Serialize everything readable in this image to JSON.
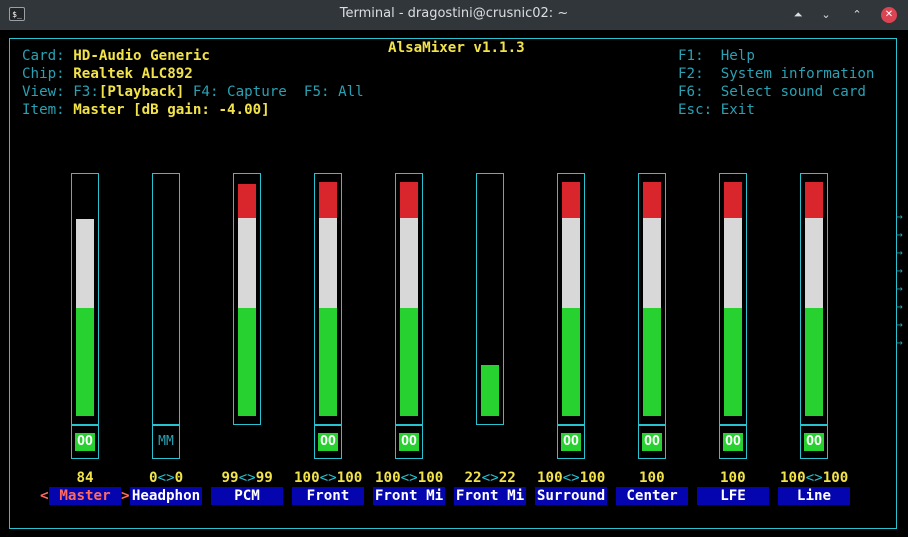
{
  "window": {
    "title": "Terminal - dragostini@crusnic02: ~",
    "app_icon": "$_",
    "buttons": {
      "keep_above": "⏶",
      "minimize": "⌄",
      "maximize": "⌃",
      "close": "✕"
    }
  },
  "app": {
    "title": "AlsaMixer v1.1.3"
  },
  "info": {
    "card_label": "Card:",
    "card_value": "HD-Audio Generic",
    "chip_label": "Chip:",
    "chip_value": "Realtek ALC892",
    "view_label": "View:",
    "view_f3": "F3:",
    "view_f3_value": "[Playback]",
    "view_f4": "F4: Capture",
    "view_f5": "F5: All",
    "item_label": "Item:",
    "item_value": "Master [dB gain: -4.00]"
  },
  "keys": [
    {
      "key": "F1:",
      "action": "Help"
    },
    {
      "key": "F2:",
      "action": "System information"
    },
    {
      "key": "F6:",
      "action": "Select sound card"
    },
    {
      "key": "Esc:",
      "action": "Exit"
    }
  ],
  "channels": [
    {
      "name": "Master",
      "selected": true,
      "value_left": "84",
      "value_sep": "",
      "value_right": "",
      "level": 0.84,
      "switch": "OO",
      "has_switch": true
    },
    {
      "name": "Headphon",
      "selected": false,
      "value_left": "0",
      "value_sep": "<>",
      "value_right": "0",
      "level": 0.0,
      "switch": "MM",
      "has_switch": true
    },
    {
      "name": "PCM",
      "selected": false,
      "value_left": "99",
      "value_sep": "<>",
      "value_right": "99",
      "level": 0.99,
      "switch": "",
      "has_switch": false
    },
    {
      "name": "Front",
      "selected": false,
      "value_left": "100",
      "value_sep": "<>",
      "value_right": "100",
      "level": 1.0,
      "switch": "OO",
      "has_switch": true
    },
    {
      "name": "Front Mi",
      "selected": false,
      "value_left": "100",
      "value_sep": "<>",
      "value_right": "100",
      "level": 1.0,
      "switch": "OO",
      "has_switch": true
    },
    {
      "name": "Front Mi",
      "selected": false,
      "value_left": "22",
      "value_sep": "<>",
      "value_right": "22",
      "level": 0.22,
      "switch": "",
      "has_switch": false
    },
    {
      "name": "Surround",
      "selected": false,
      "value_left": "100",
      "value_sep": "<>",
      "value_right": "100",
      "level": 1.0,
      "switch": "OO",
      "has_switch": true
    },
    {
      "name": "Center",
      "selected": false,
      "value_left": "100",
      "value_sep": "",
      "value_right": "",
      "level": 1.0,
      "switch": "OO",
      "has_switch": true
    },
    {
      "name": "LFE",
      "selected": false,
      "value_left": "100",
      "value_sep": "",
      "value_right": "",
      "level": 1.0,
      "switch": "OO",
      "has_switch": true
    },
    {
      "name": "Line",
      "selected": false,
      "value_left": "100",
      "value_sep": "<>",
      "value_right": "100",
      "level": 1.0,
      "switch": "OO",
      "has_switch": true
    }
  ],
  "selection_markers": {
    "left": "<",
    "right": ">"
  },
  "scroll_arrows": [
    "→",
    "→",
    "→",
    "→",
    "→",
    "→",
    "→",
    "→"
  ],
  "colors": {
    "frame": "#28c2d1",
    "highlight": "#f2e34b",
    "level_red": "#d9262d",
    "level_white": "#d8d8d8",
    "level_green": "#27d12f",
    "name_bg": "#0505b0",
    "selected": "#ff6a5f"
  }
}
